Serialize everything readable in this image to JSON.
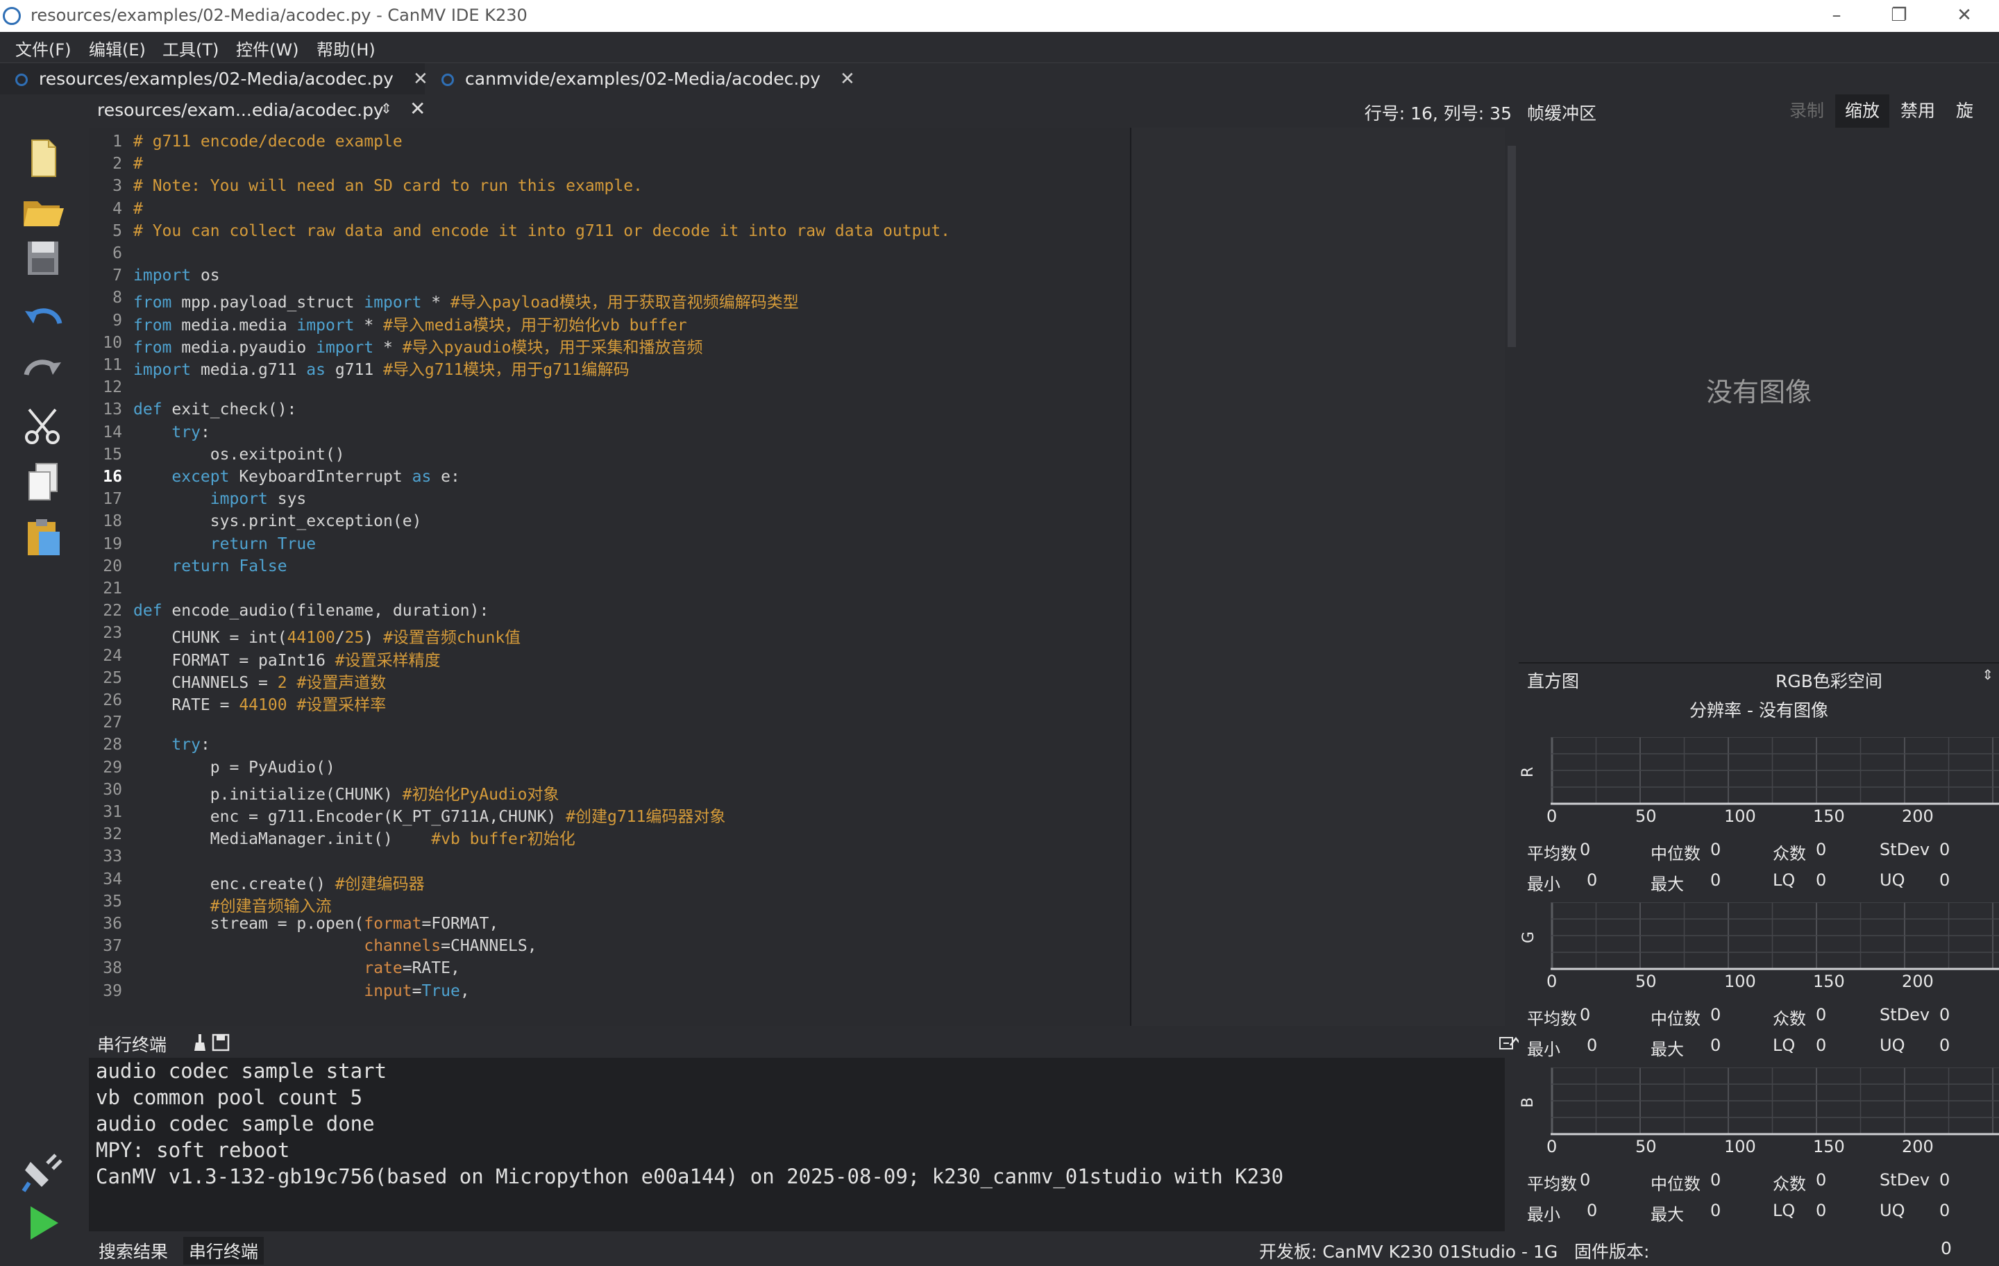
{
  "window": {
    "title": "resources/examples/02-Media/acodec.py - CanMV IDE K230",
    "min": "–",
    "max": "❐",
    "close": "✕"
  },
  "menu": [
    "文件(F)",
    "编辑(E)",
    "工具(T)",
    "控件(W)",
    "帮助(H)"
  ],
  "file_tabs": [
    {
      "label": "resources/examples/02-Media/acodec.py",
      "close": "✕"
    },
    {
      "label": "canmvide/examples/02-Media/acodec.py",
      "close": "✕"
    }
  ],
  "editor_header": {
    "path": "resources/exam...edia/acodec.py",
    "updown": "⇕",
    "close": "✕",
    "position": "行号: 16, 列号: 35"
  },
  "code_lines": [
    "# g711 encode/decode example",
    "#",
    "# Note: You will need an SD card to run this example.",
    "#",
    "# You can collect raw data and encode it into g711 or decode it into raw data output.",
    "",
    "import os",
    "from mpp.payload_struct import * #导入payload模块，用于获取音视频编解码类型",
    "from media.media import * #导入media模块，用于初始化vb buffer",
    "from media.pyaudio import * #导入pyaudio模块，用于采集和播放音频",
    "import media.g711 as g711 #导入g711模块，用于g711编解码",
    "",
    "def exit_check():",
    "    try:",
    "        os.exitpoint()",
    "    except KeyboardInterrupt as e:",
    "        import sys",
    "        sys.print_exception(e)",
    "        return True",
    "    return False",
    "",
    "def encode_audio(filename, duration):",
    "    CHUNK = int(44100/25) #设置音频chunk值",
    "    FORMAT = paInt16 #设置采样精度",
    "    CHANNELS = 2 #设置声道数",
    "    RATE = 44100 #设置采样率",
    "",
    "    try:",
    "        p = PyAudio()",
    "        p.initialize(CHUNK) #初始化PyAudio对象",
    "        enc = g711.Encoder(K_PT_G711A,CHUNK) #创建g711编码器对象",
    "        MediaManager.init()    #vb buffer初始化",
    "",
    "        enc.create() #创建编码器",
    "        #创建音频输入流",
    "        stream = p.open(format=FORMAT,",
    "                        channels=CHANNELS,",
    "                        rate=RATE,",
    "                        input=True,"
  ],
  "current_line": 16,
  "terminal": {
    "label": "串行终端",
    "lines": [
      "audio codec sample start",
      "vb common pool count 5",
      "audio codec sample done",
      "MPY: soft reboot",
      "CanMV v1.3-132-gb19c756(based on Micropython e00a144) on 2025-08-09; k230_canmv_01studio with K230"
    ]
  },
  "bottom_tabs": [
    "搜索结果",
    "串行终端"
  ],
  "status": {
    "board": "开发板: CanMV K230 01Studio - 1G",
    "firmware": "固件版本:",
    "port_value": "0"
  },
  "framebuffer": {
    "label": "帧缓冲区",
    "buttons": [
      "录制",
      "缩放",
      "禁用",
      "旋转"
    ],
    "no_image": "没有图像"
  },
  "histogram": {
    "label": "直方图",
    "color_space": "RGB色彩空间",
    "title": "分辨率 - 没有图像",
    "ticks": [
      "0",
      "50",
      "100",
      "150",
      "200"
    ],
    "channels": [
      {
        "name": "R"
      },
      {
        "name": "G"
      },
      {
        "name": "B"
      }
    ],
    "stats": {
      "mean_label": "平均数",
      "mean": "0",
      "median_label": "中位数",
      "median": "0",
      "mode_label": "众数",
      "mode": "0",
      "stdev_label": "StDev",
      "stdev": "0",
      "min_label": "最小",
      "min": "0",
      "max_label": "最大",
      "max": "0",
      "lq_label": "LQ",
      "lq": "0",
      "uq_label": "UQ",
      "uq": "0"
    }
  },
  "colors": {
    "background": "#1f2023",
    "panel": "#2b2c30",
    "comment": "#d59b3a",
    "keyword": "#4fa3d1",
    "accent_blue": "#2f6fb5"
  }
}
